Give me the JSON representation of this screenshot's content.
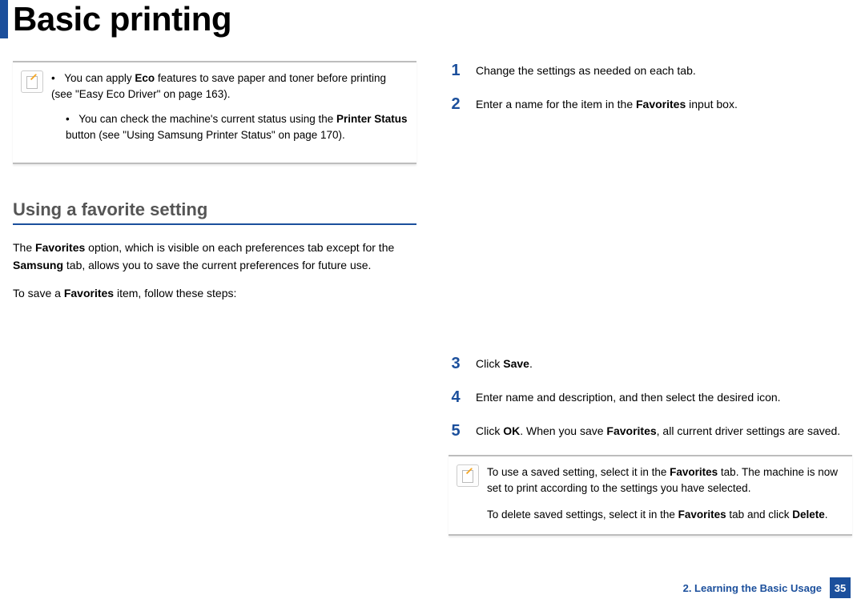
{
  "title": "Basic printing",
  "left": {
    "note_items": [
      {
        "pre": "You can apply ",
        "b1": "Eco",
        "post1": " features to save paper and toner before printing (see \"Easy Eco Driver\" on page 163)."
      },
      {
        "pre": "You can check the machine's current status using the ",
        "b1": "Printer Status",
        "post1": " button (see \"Using Samsung Printer Status\" on page 170)."
      }
    ],
    "section_heading": "Using a favorite setting",
    "para1_pre": "The ",
    "para1_b1": "Favorites",
    "para1_mid": " option, which is visible on each preferences tab except for the ",
    "para1_b2": "Samsung",
    "para1_post": " tab, allows you to save the current preferences for future use.",
    "para2_pre": "To save a ",
    "para2_b1": "Favorites",
    "para2_post": " item, follow these steps:"
  },
  "right": {
    "steps_top": [
      {
        "n": "1",
        "pre": "Change the settings as needed on each tab.",
        "b1": "",
        "post": ""
      },
      {
        "n": "2",
        "pre": "Enter a name for the item in the ",
        "b1": "Favorites",
        "post": " input box."
      }
    ],
    "steps_mid": [
      {
        "n": "3",
        "pre": "Click ",
        "b1": "Save",
        "post": "."
      },
      {
        "n": "4",
        "pre": "Enter name and description, and then select the desired icon.",
        "b1": "",
        "post": ""
      },
      {
        "n": "5",
        "pre": "Click ",
        "b1": "OK",
        "mid": ". When you save ",
        "b2": "Favorites",
        "post": ", all current driver settings are saved."
      }
    ],
    "note2_p1_pre": "To use a saved setting, select it in the ",
    "note2_p1_b1": "Favorites",
    "note2_p1_post": " tab. The machine is now set to print according to the settings you have selected.",
    "note2_p2_pre": "To delete saved settings, select it in the ",
    "note2_p2_b1": "Favorites",
    "note2_p2_mid": " tab and click ",
    "note2_p2_b2": "Delete",
    "note2_p2_post": "."
  },
  "footer": {
    "chapter": "2. Learning the Basic Usage",
    "page": "35"
  }
}
